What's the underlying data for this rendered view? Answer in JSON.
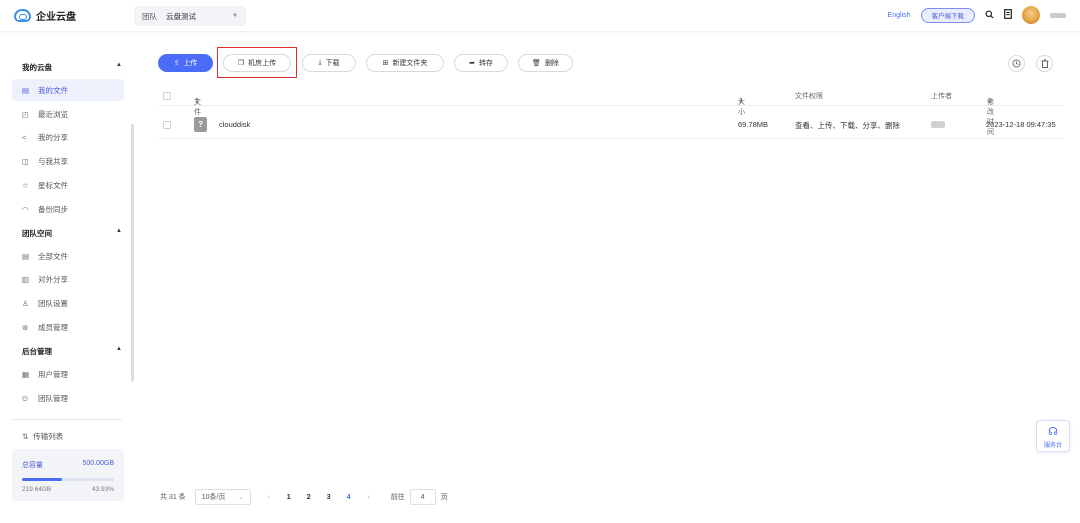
{
  "app": {
    "logo_text": "企业云盘"
  },
  "header": {
    "team_label": "团队",
    "team_value": "云盘测试",
    "language": "English",
    "client_download": "客户端下载"
  },
  "sidebar": {
    "sections": [
      {
        "title": "我的云盘",
        "items": [
          {
            "label": "我的文件",
            "icon": "file-icon",
            "active": true
          },
          {
            "label": "最近浏览",
            "icon": "recent-icon"
          },
          {
            "label": "我的分享",
            "icon": "share-icon"
          },
          {
            "label": "与我共享",
            "icon": "shared-with-me-icon"
          },
          {
            "label": "星标文件",
            "icon": "star-icon"
          },
          {
            "label": "备份同步",
            "icon": "sync-icon"
          }
        ]
      },
      {
        "title": "团队空间",
        "items": [
          {
            "label": "全部文件",
            "icon": "all-files-icon"
          },
          {
            "label": "对外分享",
            "icon": "external-share-icon"
          },
          {
            "label": "团队设置",
            "icon": "team-settings-icon"
          },
          {
            "label": "成员管理",
            "icon": "members-icon"
          }
        ]
      },
      {
        "title": "后台管理",
        "items": [
          {
            "label": "用户管理",
            "icon": "users-icon"
          },
          {
            "label": "团队管理",
            "icon": "team-admin-icon"
          }
        ]
      }
    ],
    "transfer_list": "传输列表",
    "storage": {
      "total_label": "总容量",
      "total": "500.00GB",
      "used": "219.64GB",
      "percent": "43.93%",
      "fraction": 0.4393
    }
  },
  "toolbar": {
    "upload": "上传",
    "room_upload": "机房上传",
    "download": "下载",
    "new_folder": "新建文件夹",
    "transfer_save": "转存",
    "delete": "删除"
  },
  "table": {
    "columns": [
      "文件名",
      "大小",
      "文件权限",
      "上传者",
      "修改时间"
    ],
    "rows": [
      {
        "name": "clouddisk",
        "size": "69.78MB",
        "permissions": "查看、上传、下载、分享、删除",
        "modified": "2023-12-18 09:47:35"
      }
    ]
  },
  "pagination": {
    "total": "共 31 条",
    "page_size": "10条/页",
    "pages": [
      "1",
      "2",
      "3",
      "4"
    ],
    "current": "4",
    "goto_label": "前往",
    "goto_value": "4",
    "page_unit": "页"
  },
  "service": {
    "label": "服务台"
  }
}
